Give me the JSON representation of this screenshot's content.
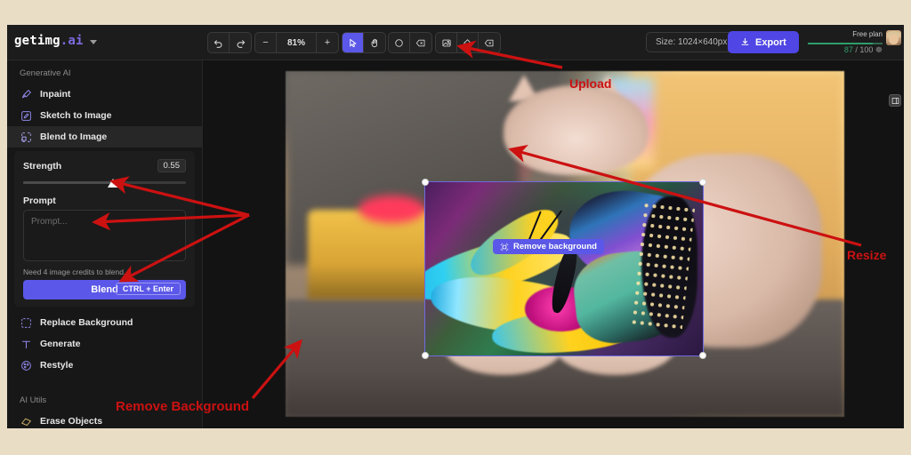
{
  "app": {
    "brand_name": "getimg",
    "brand_suffix": ".ai",
    "brand_caret": "chevron-down"
  },
  "toolbar": {
    "undo_icon": "undo-icon",
    "redo_icon": "redo-icon",
    "zoom_out_label": "−",
    "zoom_level": "81%",
    "zoom_in_label": "+",
    "tools": [
      {
        "name": "select-tool",
        "icon": "cursor-icon",
        "active": true
      },
      {
        "name": "hand-tool",
        "icon": "hand-icon",
        "active": false
      },
      {
        "name": "ellipse-tool",
        "icon": "circle-icon",
        "active": false
      },
      {
        "name": "tag-tool",
        "icon": "tag-icon",
        "active": false
      },
      {
        "name": "upload-image-tool",
        "icon": "image-upload-icon",
        "active": false
      },
      {
        "name": "shape-tool",
        "icon": "diamond-icon",
        "active": false
      },
      {
        "name": "label-tool",
        "icon": "tag-icon",
        "active": false
      }
    ],
    "size_label": "Size: 1024×640px",
    "export_label": "Export",
    "export_icon": "download-icon"
  },
  "account": {
    "plan_label": "Free plan",
    "credits_used": "87",
    "credits_separator": "/",
    "credits_total": "100",
    "credits_icon": "credits-icon",
    "progress_percent": 87,
    "avatar": "user-avatar"
  },
  "sidebar": {
    "section_generative": "Generative AI",
    "section_utils": "AI Utils",
    "items": [
      {
        "label": "Inpaint",
        "icon": "brush-icon",
        "selected": false
      },
      {
        "label": "Sketch to Image",
        "icon": "pencil-square-icon",
        "selected": false
      },
      {
        "label": "Blend to Image",
        "icon": "blend-icon",
        "selected": true
      }
    ],
    "items_after": [
      {
        "label": "Replace Background",
        "icon": "replace-background-icon"
      },
      {
        "label": "Generate",
        "icon": "text-generate-icon"
      },
      {
        "label": "Restyle",
        "icon": "palette-icon"
      }
    ],
    "utils": [
      {
        "label": "Erase Objects",
        "icon": "eraser-icon"
      }
    ]
  },
  "blend_panel": {
    "strength_label": "Strength",
    "strength_value": "0.55",
    "strength_percent": 55,
    "prompt_label": "Prompt",
    "prompt_value": "",
    "prompt_placeholder": "Prompt...",
    "credits_note": "Need 4 image credits to blend.",
    "blend_button": "Blend",
    "blend_shortcut": "CTRL + Enter"
  },
  "canvas": {
    "remove_background_label": "Remove background",
    "remove_background_icon": "remove-background-icon",
    "panel_toggle_icon": "panel-toggle-icon",
    "selection_handles": [
      "top-left",
      "top-right",
      "bottom-left",
      "bottom-right"
    ]
  },
  "annotations": [
    {
      "id": "upload",
      "text": "Upload"
    },
    {
      "id": "resize",
      "text": "Resize"
    },
    {
      "id": "remove_background",
      "text": "Remove Background"
    }
  ],
  "colors": {
    "accent": "#5b57e8",
    "export": "#4f46e5",
    "annotation_red": "#cc1111",
    "credits_green": "#2e9e6b",
    "page_border": "#e9ddc6",
    "app_background": "#131313",
    "sidebar_background": "#171717"
  }
}
